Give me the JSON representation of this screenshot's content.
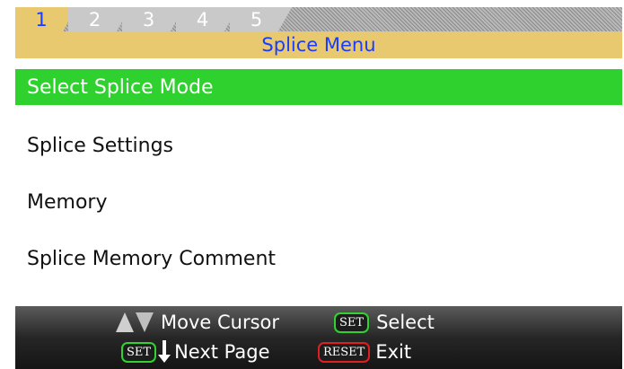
{
  "tabs": [
    {
      "label": "1",
      "active": true
    },
    {
      "label": "2",
      "active": false
    },
    {
      "label": "3",
      "active": false
    },
    {
      "label": "4",
      "active": false
    },
    {
      "label": "5",
      "active": false
    }
  ],
  "header": {
    "title": "Splice Menu"
  },
  "menu": {
    "selected_index": 0,
    "items": [
      {
        "label": "Select Splice Mode"
      },
      {
        "label": "Splice Settings"
      },
      {
        "label": "Memory"
      },
      {
        "label": "Splice Memory Comment"
      }
    ]
  },
  "footer": {
    "move_cursor": "Move Cursor",
    "set_key": "SET",
    "select": "Select",
    "next_page": "Next Page",
    "reset_key": "RESET",
    "exit": "Exit"
  },
  "colors": {
    "header_bg": "#e9c96f",
    "title_text": "#1a3cff",
    "selected_bg": "#2fd12f",
    "set_key_border": "#32d232",
    "reset_key_border": "#e02020"
  },
  "icons": [
    "up-triangle-icon",
    "down-triangle-icon",
    "down-arrow-icon"
  ]
}
